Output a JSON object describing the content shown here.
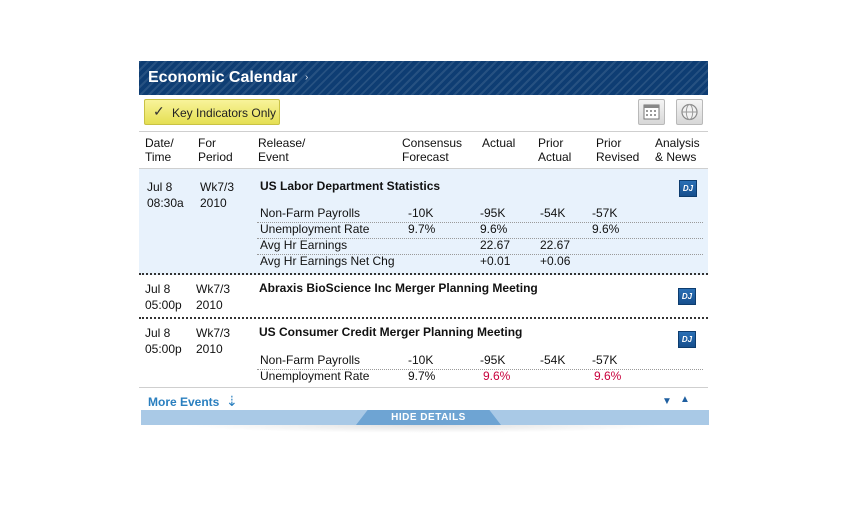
{
  "header": {
    "title": "Economic Calendar",
    "chevron": "›"
  },
  "toolbar": {
    "key_indicators_label": "Key Indicators Only",
    "check_icon": "✓",
    "calendar_icon": "calendar-icon",
    "globe_icon": "globe-icon"
  },
  "columns": {
    "date_1": "Date/",
    "date_2": "Time",
    "period_1": "For",
    "period_2": "Period",
    "release_1": "Release/",
    "release_2": "Event",
    "consensus_1": "Consensus",
    "consensus_2": "Forecast",
    "actual": "Actual",
    "prior_1": "Prior",
    "prior_2": "Actual",
    "revised_1": "Prior",
    "revised_2": "Revised",
    "analysis_1": "Analysis",
    "analysis_2": "& News"
  },
  "events": [
    {
      "date": "Jul 8",
      "time": "08:30a",
      "period_1": "Wk7/3",
      "period_2": "2010",
      "title": "US Labor Department Statistics",
      "badge": "DJ",
      "rows": [
        {
          "name": "Non-Farm Payrolls",
          "consensus": "-10K",
          "actual": "-95K",
          "prior": "-54K",
          "revised": "-57K"
        },
        {
          "name": "Unemployment Rate",
          "consensus": "9.7%",
          "actual": "9.6%",
          "prior": "",
          "revised": "9.6%"
        },
        {
          "name": "Avg Hr Earnings",
          "consensus": "",
          "actual": "22.67",
          "prior": "22.67",
          "revised": ""
        },
        {
          "name": "Avg Hr Earnings Net Chg",
          "consensus": "",
          "actual": "+0.01",
          "prior": "+0.06",
          "revised": ""
        }
      ]
    },
    {
      "date": "Jul 8",
      "time": "05:00p",
      "period_1": "Wk7/3",
      "period_2": "2010",
      "title": "Abraxis BioScience Inc Merger Planning Meeting",
      "badge": "DJ",
      "rows": []
    },
    {
      "date": "Jul 8",
      "time": "05:00p",
      "period_1": "Wk7/3",
      "period_2": "2010",
      "title": "US Consumer Credit Merger Planning Meeting",
      "badge": "DJ",
      "rows": [
        {
          "name": "Non-Farm Payrolls",
          "consensus": "-10K",
          "actual": "-95K",
          "prior": "-54K",
          "revised": "-57K"
        },
        {
          "name": "Unemployment Rate",
          "consensus": "9.7%",
          "actual": "9.6%",
          "prior": "",
          "revised": "9.6%"
        }
      ]
    }
  ],
  "footer": {
    "more_events": "More Events",
    "more_icon": "⇣",
    "down_arrow": "▼",
    "up_arrow": "▲",
    "hide_details": "HIDE DETAILS"
  },
  "colors": {
    "header_bg": "#0e3d73",
    "highlight_row": "#e8f2fc",
    "negative": "#c8003c",
    "link": "#2a7fbf"
  }
}
